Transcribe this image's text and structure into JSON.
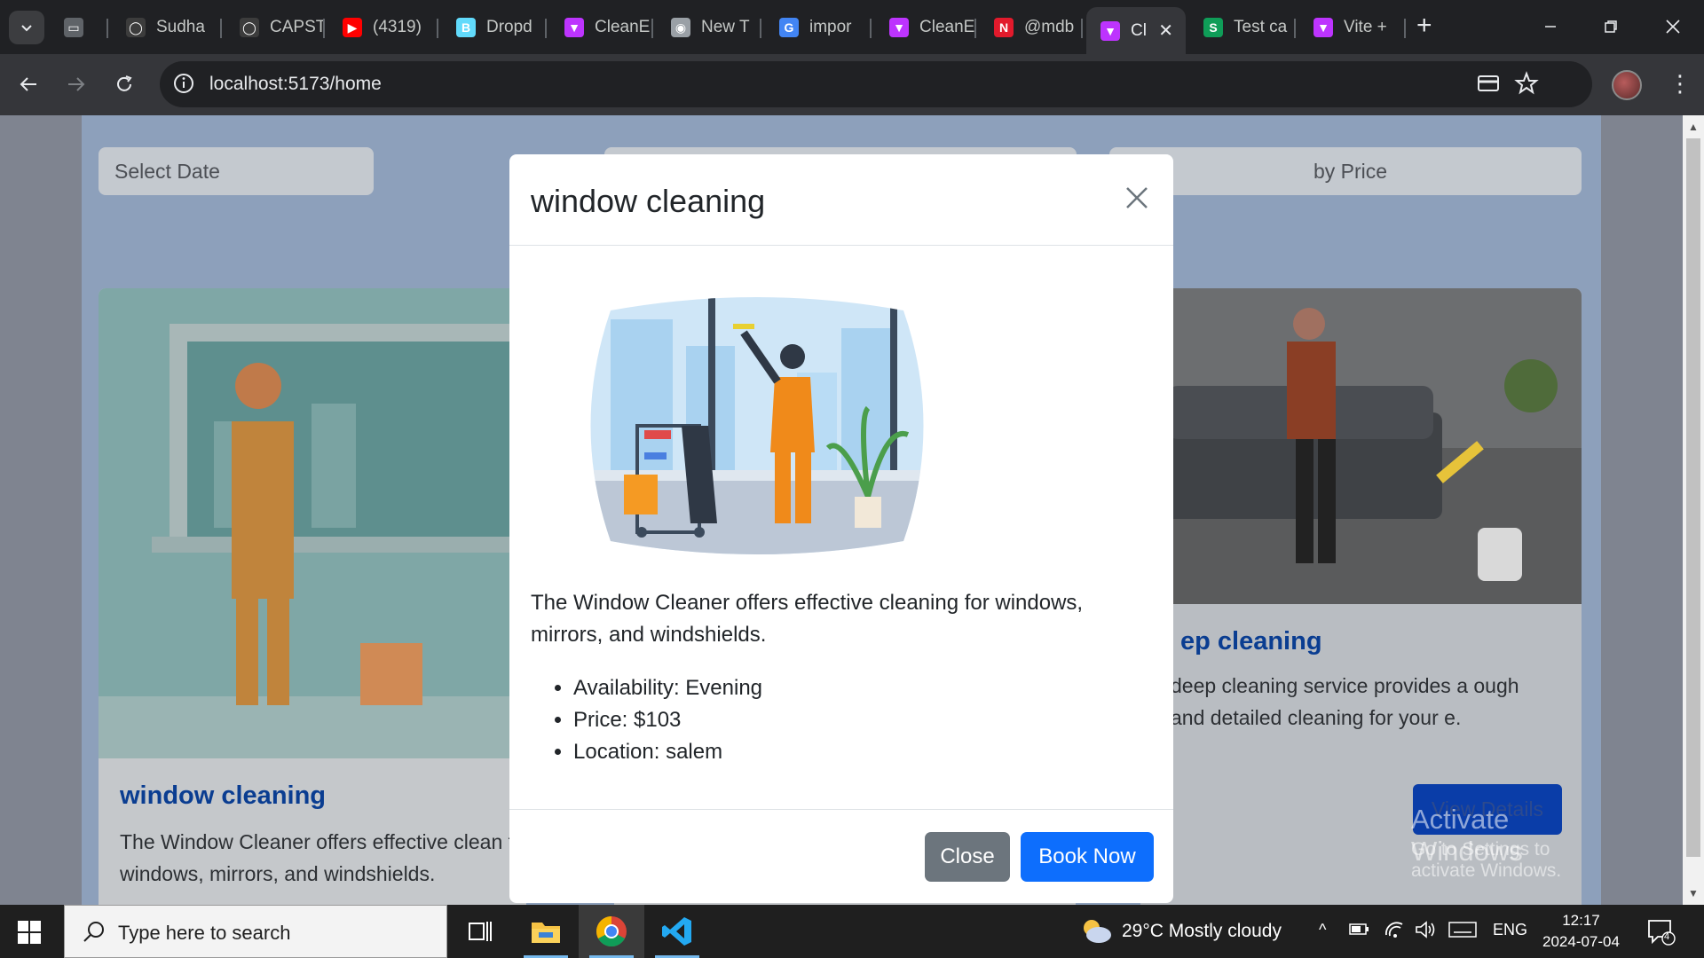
{
  "browser": {
    "tabs": [
      {
        "label": "",
        "icon": "window-icon",
        "color": "#5f6368"
      },
      {
        "label": "Sudha",
        "icon": "github-icon",
        "color": "#3c3c3c"
      },
      {
        "label": "CAPST",
        "icon": "github-icon",
        "color": "#3c3c3c"
      },
      {
        "label": "(4319)",
        "icon": "youtube-icon",
        "color": "#ff0000"
      },
      {
        "label": "Dropd",
        "icon": "react-bootstrap-icon",
        "color": "#61dafb"
      },
      {
        "label": "CleanE",
        "icon": "vite-icon",
        "color": "#bd34fe"
      },
      {
        "label": "New T",
        "icon": "chrome-icon",
        "color": "#9aa0a6"
      },
      {
        "label": "impor",
        "icon": "google-icon",
        "color": "#4285f4"
      },
      {
        "label": "CleanE",
        "icon": "vite-icon",
        "color": "#bd34fe"
      },
      {
        "label": "@mdb",
        "icon": "mdb-icon",
        "color": "#e21a2c"
      },
      {
        "label": "Cl",
        "icon": "vite-icon",
        "color": "#bd34fe",
        "active": true
      },
      {
        "label": "Test ca",
        "icon": "sheets-icon",
        "color": "#0f9d58"
      },
      {
        "label": "Vite +",
        "icon": "vite-icon",
        "color": "#bd34fe"
      }
    ],
    "url": "localhost:5173/home"
  },
  "page": {
    "filters": {
      "date_placeholder": "Select Date",
      "price_partial": "by Price"
    },
    "cards": [
      {
        "title": "window cleaning",
        "text": "The Window Cleaner offers effective clean for windows, mirrors, and windshields."
      },
      {
        "title": "ep cleaning",
        "text": "deep cleaning service provides a ough and detailed cleaning for your e.",
        "button": "View Details"
      }
    ],
    "watermark": {
      "line1": "Activate Windows",
      "line2": "Go to Settings to activate Windows."
    }
  },
  "modal": {
    "title": "window cleaning",
    "description": "The Window Cleaner offers effective cleaning for windows, mirrors, and windshields.",
    "details": [
      "Availability: Evening",
      "Price: $103",
      "Location: salem"
    ],
    "close_label": "Close",
    "book_label": "Book Now",
    "colors": {
      "primary": "#0d6efd",
      "secondary": "#6c757d"
    }
  },
  "taskbar": {
    "search_placeholder": "Type here to search",
    "weather": "29°C  Mostly cloudy",
    "language": "ENG",
    "time": "12:17",
    "date": "2024-07-04",
    "notifications": "4"
  }
}
